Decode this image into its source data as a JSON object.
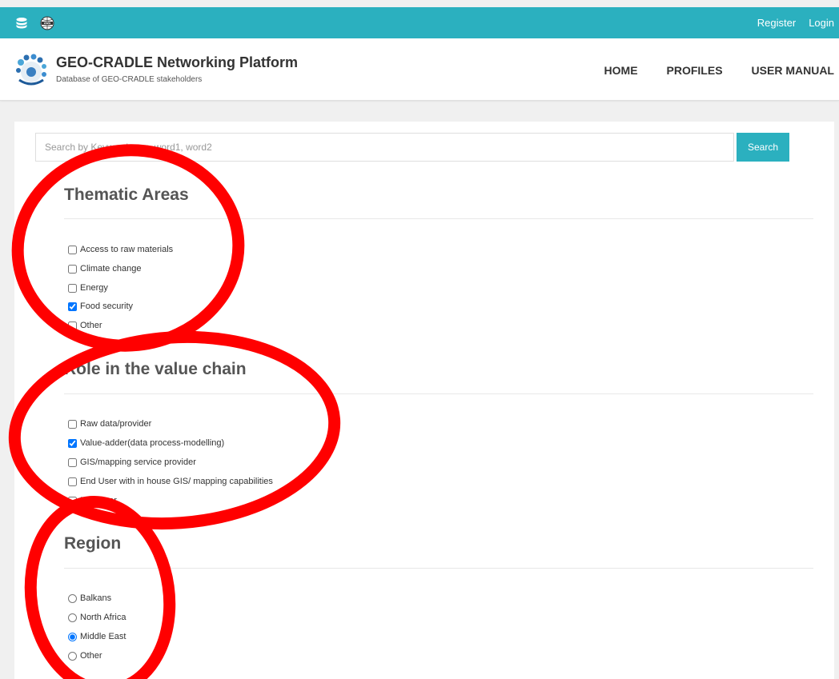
{
  "topbar": {
    "icons": [
      "database-icon",
      "www-globe-icon"
    ],
    "links": [
      "Register",
      "Login"
    ],
    "color": "#2bb0bf"
  },
  "header": {
    "title": "GEO-CRADLE Networking Platform",
    "subtitle": "Database of GEO-CRADLE stakeholders",
    "nav": [
      "HOME",
      "PROFILES",
      "USER MANUAL"
    ]
  },
  "search": {
    "placeholder": "Search by Keywords e.g. word1, word2",
    "button_label": "Search"
  },
  "sections": {
    "thematic": {
      "title": "Thematic Areas",
      "options": [
        {
          "label": "Access to raw materials",
          "checked": false
        },
        {
          "label": "Climate change",
          "checked": false
        },
        {
          "label": "Energy",
          "checked": false
        },
        {
          "label": "Food security",
          "checked": true
        },
        {
          "label": "Other",
          "checked": false
        }
      ]
    },
    "role": {
      "title": "Role in the value chain",
      "options": [
        {
          "label": "Raw data/provider",
          "checked": false
        },
        {
          "label": "Value-adder(data process-modelling)",
          "checked": true
        },
        {
          "label": "GIS/mapping service provider",
          "checked": false
        },
        {
          "label": "End User with in house GIS/ mapping capabilities",
          "checked": false
        },
        {
          "label": "End User",
          "checked": false
        }
      ]
    },
    "region": {
      "title": "Region",
      "options": [
        {
          "label": "Balkans",
          "checked": false
        },
        {
          "label": "North Africa",
          "checked": false
        },
        {
          "label": "Middle East",
          "checked": true
        },
        {
          "label": "Other",
          "checked": false
        }
      ]
    }
  },
  "annotation_color": "#ff0000"
}
